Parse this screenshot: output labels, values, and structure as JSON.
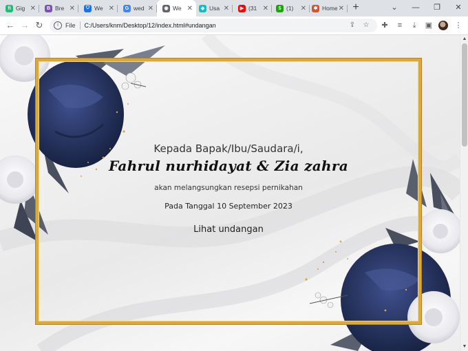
{
  "browser": {
    "tabs": [
      {
        "title": "Gig",
        "icon": "fiverr-icon",
        "color": "#1dbf73",
        "glyph": "fi"
      },
      {
        "title": "Bre",
        "icon": "bootstrap-icon",
        "color": "#7952b3",
        "glyph": "B"
      },
      {
        "title": "We",
        "icon": "shield-icon",
        "color": "#1a73e8",
        "glyph": "⛉"
      },
      {
        "title": "wed",
        "icon": "google-icon",
        "color": "#4285f4",
        "glyph": "G"
      },
      {
        "title": "We",
        "icon": "globe-icon",
        "color": "#5f6368",
        "glyph": "◉",
        "active": true
      },
      {
        "title": "Usa",
        "icon": "canva-icon",
        "color": "#00c4cc",
        "glyph": "◆"
      },
      {
        "title": "(31",
        "icon": "youtube-icon",
        "color": "#ff0000",
        "glyph": "▶"
      },
      {
        "title": "(1)",
        "icon": "upwork-icon",
        "color": "#14a800",
        "glyph": "$"
      },
      {
        "title": "Home",
        "icon": "sandbox-icon",
        "color": "#e44d26",
        "glyph": "✱"
      }
    ],
    "new_tab": "+",
    "window_controls": {
      "dropdown": "⌄",
      "minimize": "—",
      "restore": "❐",
      "close": "✕"
    },
    "toolbar": {
      "back": "←",
      "forward": "→",
      "reload": "↻",
      "scheme_label": "File",
      "url": "C:/Users/knm/Desktop/12/index.html#undangan"
    }
  },
  "invitation": {
    "greeting": "Kepada Bapak/Ibu/Saudara/i,",
    "guest_names": "Fahrul nurhidayat & Zia zahra",
    "announcement": "akan melangsungkan resepsi pernikahan",
    "date_line": "Pada Tanggal 10 September 2023",
    "open_button": "Lihat undangan"
  },
  "colors": {
    "frame_gold": "#d9a93e",
    "flower_navy": "#2e3d6b",
    "flower_white": "#f2f2f4",
    "leaf_gray": "#5a5f6e"
  }
}
